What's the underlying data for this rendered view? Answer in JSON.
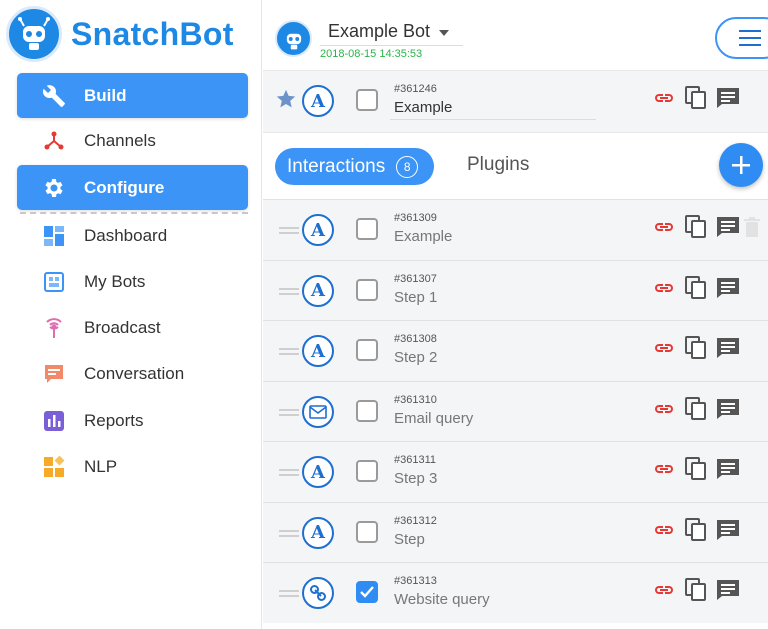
{
  "brand": {
    "name": "SnatchBot"
  },
  "sidebar": {
    "primary": [
      {
        "label": "Build",
        "icon": "wrench-icon"
      },
      {
        "label": "Configure",
        "icon": "gear-icon"
      }
    ],
    "channels_label": "Channels",
    "items": [
      {
        "label": "Dashboard",
        "icon": "dashboard-icon"
      },
      {
        "label": "My Bots",
        "icon": "bots-icon"
      },
      {
        "label": "Broadcast",
        "icon": "broadcast-icon"
      },
      {
        "label": "Conversation",
        "icon": "conversation-icon"
      },
      {
        "label": "Reports",
        "icon": "reports-icon"
      },
      {
        "label": "NLP",
        "icon": "nlp-icon"
      }
    ]
  },
  "bot": {
    "name": "Example Bot",
    "date": "2018-08-15 14:35:53"
  },
  "start": {
    "id": "#361246",
    "name": "Example"
  },
  "tabs": {
    "interactions": "Interactions",
    "count": "8",
    "plugins": "Plugins"
  },
  "interactions": [
    {
      "id": "#361309",
      "name": "Example",
      "type": "A",
      "checked": false
    },
    {
      "id": "#361307",
      "name": "Step 1",
      "type": "A",
      "checked": false
    },
    {
      "id": "#361308",
      "name": "Step 2",
      "type": "A",
      "checked": false
    },
    {
      "id": "#361310",
      "name": "Email query",
      "type": "email",
      "checked": false
    },
    {
      "id": "#361311",
      "name": "Step 3",
      "type": "A",
      "checked": false
    },
    {
      "id": "#361312",
      "name": "Step",
      "type": "A",
      "checked": false
    },
    {
      "id": "#361313",
      "name": "Website query",
      "type": "link",
      "checked": true
    }
  ],
  "colors": {
    "accent": "#3b94f6",
    "brand": "#1e88e5",
    "link_red": "#e53935",
    "date_green": "#2ab44a"
  }
}
